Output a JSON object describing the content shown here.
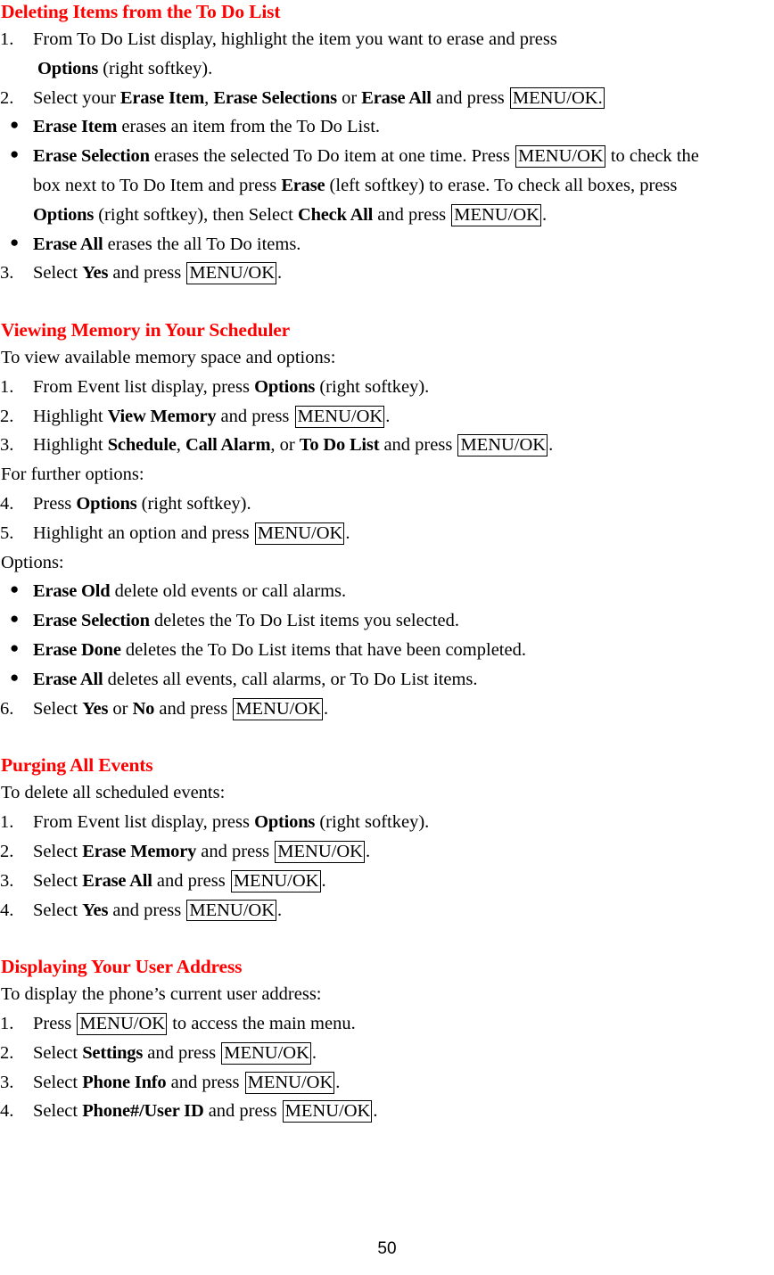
{
  "document": {
    "page_number": "50",
    "heading_color": "#FF0000",
    "body_color": "#000000",
    "keys": {
      "menu_ok": "MENU/OK",
      "menu_ok_with_period": "MENU/OK."
    }
  },
  "sections": [
    {
      "id": "deleting-items-to-do-list",
      "heading": "Deleting Items from the To Do List",
      "items": [
        {
          "type": "numbered",
          "marker": "1.",
          "parts": [
            {
              "t": "From To Do List display, highlight the item you want to erase and press"
            }
          ],
          "cont": [
            {
              "bold": "Options",
              "after": " (right softkey)."
            }
          ]
        },
        {
          "type": "numbered",
          "marker": "2.",
          "pieces": {
            "pre": "Select your ",
            "b1": "Erase Item",
            "mid1": ", ",
            "b2": "Erase Selections",
            "mid2": " or ",
            "b3": "Erase All",
            "mid3": " and press ",
            "key": "MENU/OK."
          }
        },
        {
          "type": "bullet",
          "marker": "●",
          "pieces": {
            "b1": "Erase Item",
            "post": " erases an item from the To Do List."
          }
        },
        {
          "type": "bullet",
          "marker": "●",
          "pieces": {
            "b1": "Erase Selection",
            "mid1": " erases the selected To Do item at one time. Press ",
            "key1": "MENU/OK",
            "mid2": " to check the"
          },
          "cont_line2": {
            "pre": "box next to To Do Item and press ",
            "b2": "Erase",
            "post": " (left softkey) to erase. To check all boxes, press"
          },
          "cont_line3": {
            "b3": "Options",
            "mid3": " (right softkey), then Select ",
            "b4": "Check All",
            "mid4": " and press ",
            "key2": "MENU/OK",
            "post3": "."
          }
        },
        {
          "type": "bullet",
          "marker": "●",
          "pieces": {
            "b1": "Erase All",
            "post": " erases the all To Do items."
          }
        },
        {
          "type": "numbered",
          "marker": "3.",
          "pieces": {
            "pre": "Select ",
            "b1": "Yes",
            "mid1": " and press ",
            "key": "MENU/OK",
            "post": "."
          }
        }
      ]
    },
    {
      "id": "viewing-memory-scheduler",
      "heading": "Viewing Memory in Your Scheduler",
      "intro": "To view available memory space and options:",
      "items": [
        {
          "type": "numbered",
          "marker": "1.",
          "pieces": {
            "pre": "From Event list display, press ",
            "b1": "Options",
            "post": " (right softkey)."
          }
        },
        {
          "type": "numbered",
          "marker": "2.",
          "pieces": {
            "pre": "Highlight ",
            "b1": "View Memory",
            "mid1": " and press ",
            "key": "MENU/OK",
            "post": "."
          }
        },
        {
          "type": "numbered",
          "marker": "3.",
          "pieces": {
            "pre": "Highlight ",
            "b1": "Schedule",
            "mid1": ", ",
            "b2": "Call Alarm",
            "mid2": ", or ",
            "b3": "To Do List",
            "mid3": " and press ",
            "key": "MENU/OK",
            "post": "."
          }
        }
      ],
      "mid_note": "For further options:",
      "items2": [
        {
          "type": "numbered",
          "marker": "4.",
          "pieces": {
            "pre": "Press ",
            "b1": "Options",
            "post": " (right softkey)."
          }
        },
        {
          "type": "numbered",
          "marker": "5.",
          "pieces": {
            "pre": "Highlight an option and press ",
            "key": "MENU/OK",
            "post": "."
          }
        }
      ],
      "options_label": "Options:",
      "options": [
        {
          "type": "bullet",
          "marker": "●",
          "pieces": {
            "b1": "Erase Old",
            "post": " delete old events or call alarms."
          }
        },
        {
          "type": "bullet",
          "marker": "●",
          "pieces": {
            "b1": "Erase Selection",
            "post": " deletes the To Do List items you selected."
          }
        },
        {
          "type": "bullet",
          "marker": "●",
          "pieces": {
            "b1": "Erase Done",
            "post": " deletes the To Do List items that have been completed."
          }
        },
        {
          "type": "bullet",
          "marker": "●",
          "pieces": {
            "b1": "Erase All",
            "post": " deletes all events, call alarms, or To Do List items."
          }
        }
      ],
      "items3": [
        {
          "type": "numbered",
          "marker": "6.",
          "pieces": {
            "pre": "Select ",
            "b1": "Yes",
            "mid1": " or ",
            "b2": "No",
            "mid2": " and press ",
            "key": "MENU/OK",
            "post": "."
          }
        }
      ]
    },
    {
      "id": "purging-all-events",
      "heading": "Purging All Events",
      "intro": "To delete all scheduled events:",
      "items": [
        {
          "type": "numbered",
          "marker": "1.",
          "pieces": {
            "pre": "From Event list display, press ",
            "b1": "Options",
            "post": " (right softkey)."
          }
        },
        {
          "type": "numbered",
          "marker": "2.",
          "pieces": {
            "pre": "Select ",
            "b1": "Erase Memory",
            "mid1": " and press ",
            "key": "MENU/OK",
            "post": "."
          }
        },
        {
          "type": "numbered",
          "marker": "3.",
          "pieces": {
            "pre": "Select ",
            "b1": "Erase All",
            "mid1": " and press ",
            "key": "MENU/OK",
            "post": "."
          }
        },
        {
          "type": "numbered",
          "marker": "4.",
          "pieces": {
            "pre": "Select ",
            "b1": "Yes",
            "mid1": " and press ",
            "key": "MENU/OK",
            "post": "."
          }
        }
      ]
    },
    {
      "id": "displaying-user-address",
      "heading": "Displaying Your User Address",
      "intro": "To display the phone’s current user address:",
      "items": [
        {
          "type": "numbered",
          "marker": "1.",
          "pieces": {
            "pre": "Press ",
            "key": "MENU/OK",
            "post": " to access the main menu."
          }
        },
        {
          "type": "numbered",
          "marker": "2.",
          "pieces": {
            "pre": "Select ",
            "b1": "Settings",
            "mid1": " and press ",
            "key": "MENU/OK",
            "post": "."
          }
        },
        {
          "type": "numbered",
          "marker": "3.",
          "pieces": {
            "pre": "Select ",
            "b1": "Phone Info",
            "mid1": " and press ",
            "key": "MENU/OK",
            "post": "."
          }
        },
        {
          "type": "numbered",
          "marker": "4.",
          "pieces": {
            "pre": "Select ",
            "b1": "Phone#/User ID",
            "mid1": " and press ",
            "key": "MENU/OK",
            "post": "."
          }
        }
      ]
    }
  ]
}
